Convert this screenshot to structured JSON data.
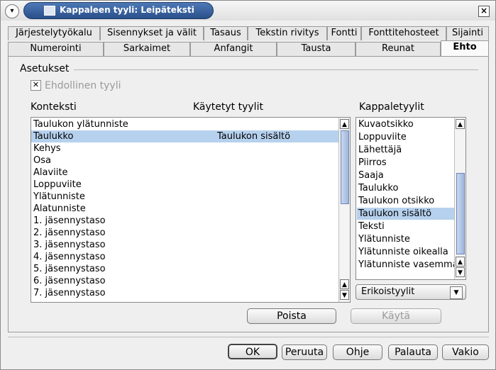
{
  "window": {
    "title": "Kappaleen tyyli: Leipäteksti"
  },
  "tabs_row1": [
    "Järjestelytyökalu",
    "Sisennykset ja välit",
    "Tasaus",
    "Tekstin rivitys",
    "Fontti",
    "Fonttitehosteet",
    "Sijainti"
  ],
  "tabs_row2": [
    "Numerointi",
    "Sarkaimet",
    "Anfangit",
    "Tausta",
    "Reunat",
    "Ehto"
  ],
  "active_tab": "Ehto",
  "settings": {
    "group_label": "Asetukset",
    "conditional_label": "Ehdollinen tyyli",
    "conditional_checked": true
  },
  "context": {
    "header": "Konteksti",
    "applied_header": "Käytetyt tyylit",
    "rows": [
      {
        "context": "Taulukon ylätunniste",
        "style": ""
      },
      {
        "context": "Taulukko",
        "style": "Taulukon sisältö",
        "selected": true
      },
      {
        "context": "Kehys",
        "style": ""
      },
      {
        "context": "Osa",
        "style": ""
      },
      {
        "context": "Alaviite",
        "style": ""
      },
      {
        "context": "Loppuviite",
        "style": ""
      },
      {
        "context": "Ylätunniste",
        "style": ""
      },
      {
        "context": "Alatunniste",
        "style": ""
      },
      {
        "context": " 1. jäsennystaso",
        "style": ""
      },
      {
        "context": " 2. jäsennystaso",
        "style": ""
      },
      {
        "context": " 3. jäsennystaso",
        "style": ""
      },
      {
        "context": " 4. jäsennystaso",
        "style": ""
      },
      {
        "context": " 5. jäsennystaso",
        "style": ""
      },
      {
        "context": " 6. jäsennystaso",
        "style": ""
      },
      {
        "context": " 7. jäsennystaso",
        "style": ""
      }
    ]
  },
  "para_styles": {
    "header": "Kappaletyylit",
    "items": [
      "Kuvaotsikko",
      "Loppuviite",
      "Lähettäjä",
      "Piirros",
      "Saaja",
      "Taulukko",
      "Taulukon otsikko",
      "Taulukon sisältö",
      "Teksti",
      "Ylätunniste",
      "Ylätunniste oikealla",
      "Ylätunniste vasemmalla"
    ],
    "selected": "Taulukon sisältö",
    "filter_value": "Erikoistyylit"
  },
  "actions": {
    "remove": "Poista",
    "apply": "Käytä"
  },
  "footer": {
    "ok": "OK",
    "cancel": "Peruuta",
    "help": "Ohje",
    "reset": "Palauta",
    "standard": "Vakio"
  }
}
